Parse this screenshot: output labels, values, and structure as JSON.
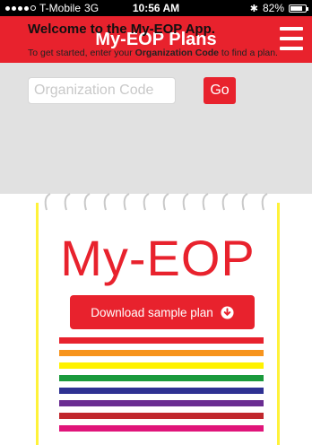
{
  "status_bar": {
    "carrier": "T-Mobile",
    "network": "3G",
    "time": "10:56 AM",
    "battery_percent": "82%",
    "battery_level": 0.82
  },
  "header": {
    "title": "My-EOP Plans",
    "menu_icon": "hamburger-icon"
  },
  "welcome": {
    "title": "Welcome to the My-EOP App.",
    "text_before": "To get started, enter your ",
    "text_bold": "Organization Code",
    "text_after": " to find a plan.",
    "input_placeholder": "Organization Code",
    "input_value": "",
    "go_label": "Go"
  },
  "notepad": {
    "wordmark": "My-EOP",
    "download_label": "Download sample plan",
    "download_icon": "download-circle-icon",
    "stripe_colors": [
      "#e8222d",
      "#f7941d",
      "#fff200",
      "#1a9a3c",
      "#2e3192",
      "#6a2c91",
      "#c1272d",
      "#e0157a"
    ],
    "border_color": "#fff23a"
  },
  "colors": {
    "brand_red": "#e8222d",
    "panel_gray": "#e1e1e1"
  }
}
